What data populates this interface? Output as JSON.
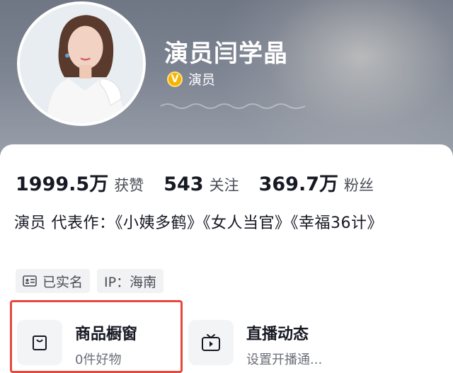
{
  "profile": {
    "name": "演员闫学晶",
    "verification_label": "演员",
    "verification_badge": "V"
  },
  "stats": [
    {
      "value": "1999.5万",
      "label": "获赞"
    },
    {
      "value": "543",
      "label": "关注"
    },
    {
      "value": "369.7万",
      "label": "粉丝"
    }
  ],
  "bio": "演员 代表作：《小姨多鹤》《女人当官》《幸福36计》",
  "tags": [
    {
      "label": "已实名",
      "icon": "id-card-icon"
    },
    {
      "label": "IP：海南",
      "icon": null
    }
  ],
  "features": {
    "shop": {
      "title": "商品橱窗",
      "subtitle": "0件好物",
      "icon": "shopping-bag-icon"
    },
    "live": {
      "title": "直播动态",
      "subtitle": "设置开播通...",
      "icon": "tv-icon"
    }
  },
  "colors": {
    "highlight_border": "#e5483d",
    "verify_badge": "#f5b400"
  }
}
